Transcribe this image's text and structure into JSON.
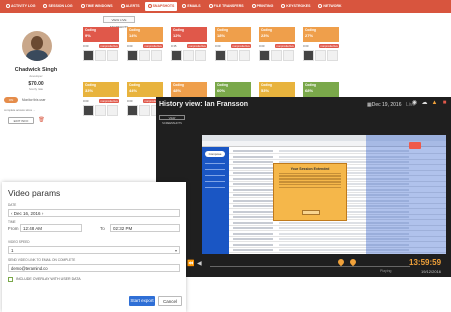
{
  "dashboard": {
    "nav": [
      {
        "label": "ACTIVITY LOG",
        "icon": "clock-icon"
      },
      {
        "label": "SESSION LOG",
        "icon": "list-icon"
      },
      {
        "label": "TIME WINDOWS",
        "icon": "window-icon"
      },
      {
        "label": "ALERTS",
        "icon": "bell-icon"
      },
      {
        "label": "SNAPSHOTS",
        "icon": "camera-icon",
        "active": true
      },
      {
        "label": "EMAILS",
        "icon": "mail-icon"
      },
      {
        "label": "FILE TRANSFERS",
        "icon": "file-icon"
      },
      {
        "label": "PRINTING",
        "icon": "printer-icon"
      },
      {
        "label": "KEYSTROKES",
        "icon": "keyboard-icon"
      },
      {
        "label": "NETWORK",
        "icon": "network-icon"
      }
    ],
    "profile": {
      "name": "Chadwick Singh",
      "role": "developer",
      "rate": "$70.00",
      "rate_label": "hourly rate",
      "toggle": "ON",
      "monitor": "Monitor this user",
      "note": "complete access since ...",
      "edit": "EDIT INFO"
    },
    "view_button": "VIEW LIVE SNAPSHOTS",
    "cards": [
      {
        "label": "Coding",
        "pct": "9%",
        "color": "red",
        "time": "0:00",
        "badge": "nonproductive"
      },
      {
        "label": "Coding",
        "pct": "14%",
        "color": "orange",
        "time": "0:00",
        "badge": "nonproductive"
      },
      {
        "label": "Coding",
        "pct": "12%",
        "color": "red",
        "time": "0:35",
        "badge": "nonproductive"
      },
      {
        "label": "Coding",
        "pct": "18%",
        "color": "orange",
        "time": "0:00",
        "badge": "nonproductive"
      },
      {
        "label": "Coding",
        "pct": "23%",
        "color": "orange",
        "time": "0:00",
        "badge": "nonproductive"
      },
      {
        "label": "Coding",
        "pct": "27%",
        "color": "orange",
        "time": "0:00",
        "badge": "nonproductive"
      },
      {
        "label": "Coding",
        "pct": "33%",
        "color": "yellow",
        "time": "0:00",
        "badge": "nonproductive"
      },
      {
        "label": "Coding",
        "pct": "44%",
        "color": "yellow",
        "time": "0:00",
        "badge": "nonproductive"
      },
      {
        "label": "Coding",
        "pct": "48%",
        "color": "orange",
        "time": "0:50",
        "badge": "nonproductive"
      },
      {
        "label": "Coding",
        "pct": "60%",
        "color": "green",
        "time": "0:00",
        "badge": "nonproductive"
      },
      {
        "label": "Coding",
        "pct": "53%",
        "color": "yellow",
        "time": "0:00",
        "badge": "nonproductive"
      },
      {
        "label": "Coding",
        "pct": "68%",
        "color": "green",
        "time": "0:00",
        "badge": "nonproductive"
      }
    ]
  },
  "history": {
    "title": "History view: Ian Fransson",
    "date": "Dec 19, 2016",
    "live": "Live",
    "sub_button": "VIEW SCREENSHOTS",
    "time": "13:59:59",
    "date_short": "19/12/2016",
    "status": "Playing",
    "dialog_title": "Your Session Extended",
    "side_button": "Compose"
  },
  "params": {
    "title": "Video params",
    "date_label": "DATE",
    "date_value": "Dec 16, 2016",
    "time_label": "TIME",
    "from_label": "From",
    "from_value": "12:48 AM",
    "to_label": "To",
    "to_value": "02:32 PM",
    "speed_label": "VIDEO SPEED",
    "speed_value": "1",
    "email_label": "SEND VIDEO LINK TO EMAIL ON COMPLETE",
    "email_value": "demo@teramind.co",
    "overlay_label": "INCLUDE OVERLAY WITH USER DATA",
    "start_label": "Start export",
    "cancel_label": "Cancel"
  }
}
